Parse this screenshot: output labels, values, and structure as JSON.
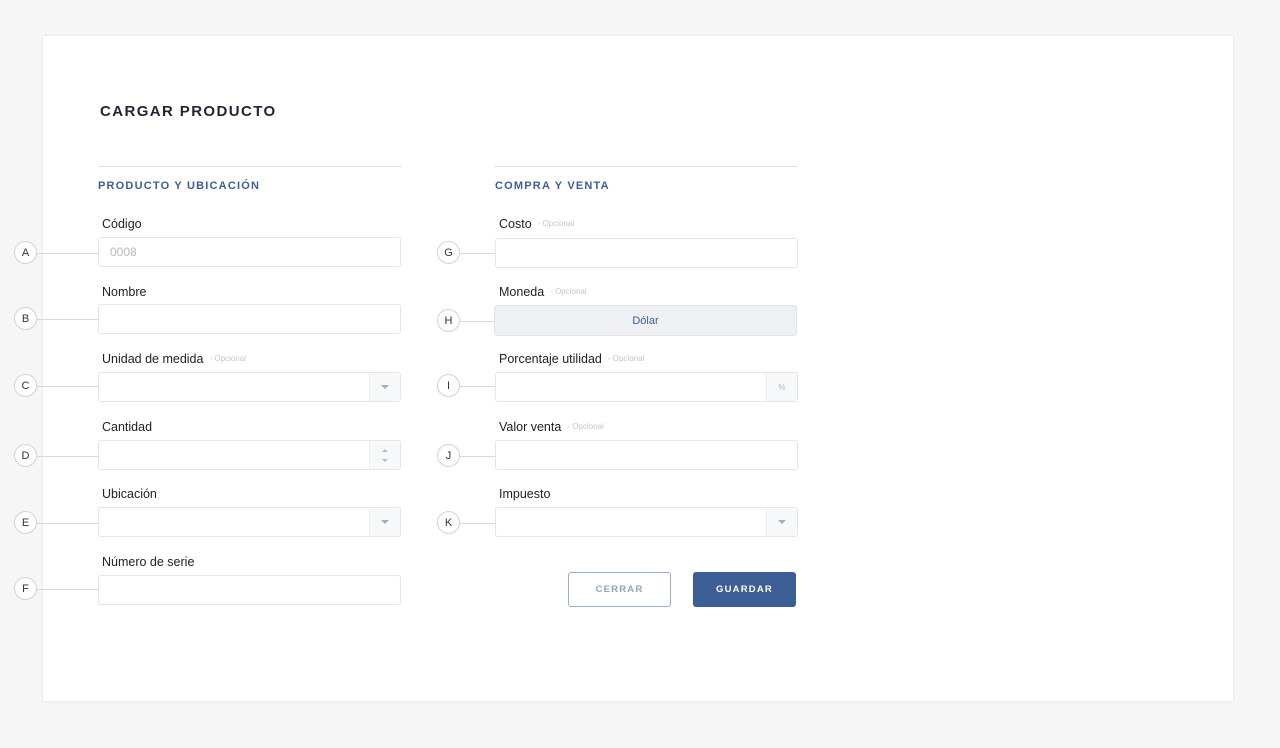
{
  "form": {
    "title": "CARGAR PRODUCTO",
    "optional_tag": "- Opcional"
  },
  "left_section": {
    "title": "PRODUCTO Y UBICACIÓN",
    "fields": {
      "codigo": {
        "label": "Código",
        "placeholder": "0008",
        "marker": "A"
      },
      "nombre": {
        "label": "Nombre",
        "value": "",
        "marker": "B"
      },
      "unidad": {
        "label": "Unidad de medida",
        "value": "",
        "marker": "C"
      },
      "cantidad": {
        "label": "Cantidad",
        "value": "",
        "marker": "D"
      },
      "ubicacion": {
        "label": "Ubicación",
        "value": "",
        "marker": "E"
      },
      "serie": {
        "label": "Número de serie",
        "value": "",
        "marker": "F"
      }
    }
  },
  "right_section": {
    "title": "COMPRA Y VENTA",
    "fields": {
      "costo": {
        "label": "Costo",
        "value": "",
        "marker": "G"
      },
      "moneda": {
        "label": "Moneda",
        "value": "Dólar",
        "marker": "H"
      },
      "porcentaje": {
        "label": "Porcentaje utilidad",
        "value": "",
        "suffix": "%",
        "marker": "I"
      },
      "valor_venta": {
        "label": "Valor venta",
        "value": "",
        "marker": "J"
      },
      "impuesto": {
        "label": "Impuesto",
        "value": "",
        "marker": "K"
      }
    }
  },
  "actions": {
    "close_label": "CERRAR",
    "save_label": "GUARDAR"
  },
  "colors": {
    "accent": "#3b5f94",
    "background": "#f6f6f6",
    "card": "#ffffff"
  }
}
